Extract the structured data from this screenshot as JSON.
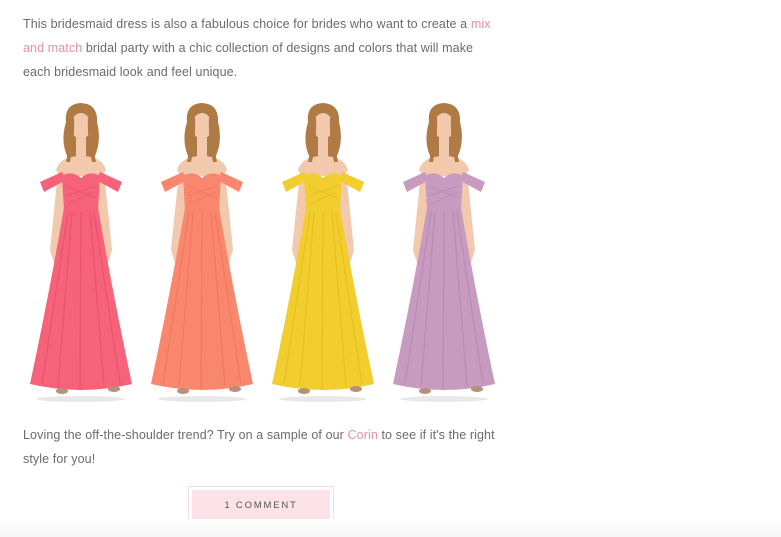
{
  "paragraph1": {
    "before_link": "This bridesmaid dress is also a fabulous choice for brides who want to create a ",
    "link_text": "mix and match",
    "after_link": " bridal party with a chic collection of designs and colors that will make each bridesmaid look and feel unique."
  },
  "dresses": [
    {
      "color_name": "coral-pink",
      "color": "#f5627a",
      "shade": "#e24a64"
    },
    {
      "color_name": "peach",
      "color": "#f9876e",
      "shade": "#ec7058"
    },
    {
      "color_name": "yellow",
      "color": "#f1cd2e",
      "shade": "#e0b81c"
    },
    {
      "color_name": "lilac",
      "color": "#c79ac0",
      "shade": "#b582ad"
    }
  ],
  "paragraph2": {
    "before_link": "Loving the off-the-shoulder trend? Try on a sample of our ",
    "link_text": "Corin",
    "after_link": " to see if it's the right style for you!"
  },
  "comments": {
    "label": "1 COMMENT"
  },
  "colors": {
    "link": "#e98fa6",
    "button_bg": "#fde3e7",
    "text": "#6b6b6b",
    "skin": "#f2c9ac",
    "hair": "#b07a45"
  }
}
